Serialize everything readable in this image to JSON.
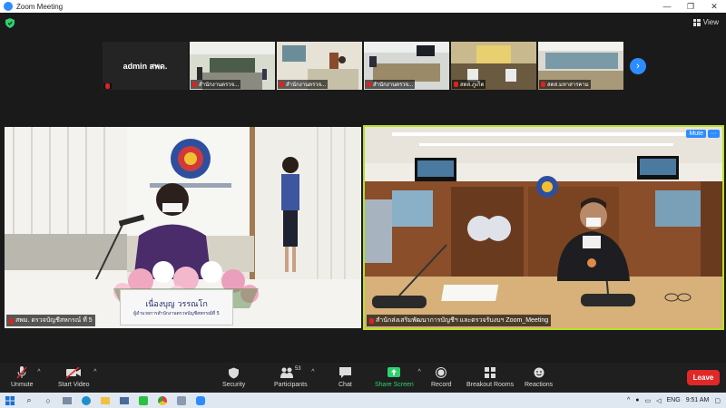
{
  "window": {
    "title": "Zoom Meeting",
    "buttons": [
      "—",
      "❐",
      "✕"
    ]
  },
  "top_bar": {
    "view_label": "View"
  },
  "thumbnails": [
    {
      "name": "admin สพด.",
      "label": "",
      "type": "name"
    },
    {
      "label": "สำนักงานตรวจ...",
      "type": "video"
    },
    {
      "label": "สำนักงานตรวจ...",
      "type": "video"
    },
    {
      "label": "สำนักงานตรวจ...",
      "type": "video"
    },
    {
      "label": "สตส.ภูเก็ต",
      "type": "video"
    },
    {
      "label": "สตส.มหาสารคาม",
      "type": "video"
    }
  ],
  "main_videos": {
    "left": {
      "label": "สพม. ตรวจบัญชีสหกรณ์ ที่ 5",
      "nameplate_name": "เนื่องบุญ วรรณโก",
      "nameplate_title": "ผู้อำนวยการสำนักงานตรวจบัญชีสหกรณ์ที่ 5"
    },
    "right": {
      "label": "สำนักส่งเสริมพัฒนาการบัญชีฯ และตรวจรับงบฯ Zoom_Meeting",
      "mute_label": "Mute",
      "more_label": "···"
    }
  },
  "toolbar": {
    "unmute": "Unmute",
    "start_video": "Start Video",
    "security": "Security",
    "participants": "Participants",
    "participants_count": "53",
    "chat": "Chat",
    "share_screen": "Share Screen",
    "record": "Record",
    "breakout_rooms": "Breakout Rooms",
    "reactions": "Reactions",
    "leave": "Leave"
  },
  "taskbar": {
    "language": "ENG",
    "time": "9:51 AM"
  },
  "colors": {
    "accent": "#2d8cff",
    "active_speaker": "#b8e028",
    "leave": "#e02828",
    "share": "#2cd36d"
  }
}
